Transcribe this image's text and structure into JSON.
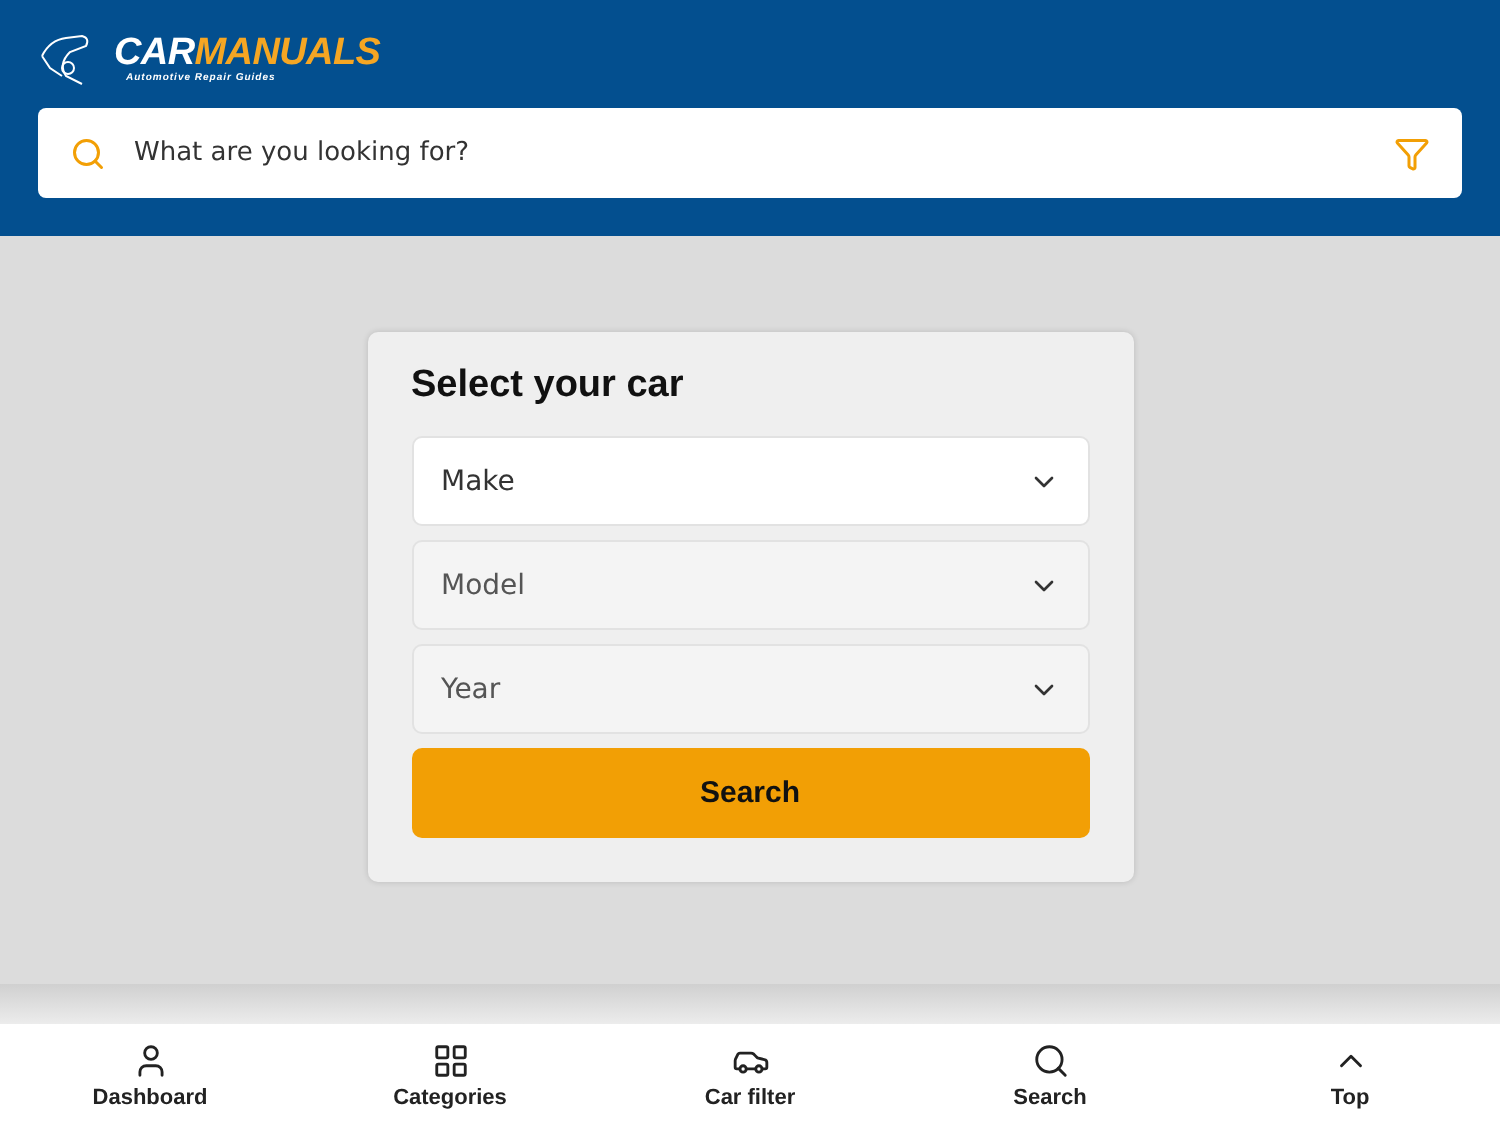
{
  "header": {
    "logo": {
      "first": "CAR",
      "second": "MANUALS",
      "tagline": "Automotive Repair Guides"
    },
    "search": {
      "placeholder": "What are you looking for?"
    }
  },
  "car_selector": {
    "title": "Select your car",
    "selects": [
      {
        "label": "Make",
        "disabled": false
      },
      {
        "label": "Model",
        "disabled": true
      },
      {
        "label": "Year",
        "disabled": true
      }
    ],
    "button": "Search"
  },
  "bottom_nav": [
    {
      "kind": "user",
      "label": "Dashboard"
    },
    {
      "kind": "grid",
      "label": "Categories"
    },
    {
      "kind": "car",
      "label": "Car filter"
    },
    {
      "kind": "search",
      "label": "Search"
    },
    {
      "kind": "up",
      "label": "Top"
    }
  ]
}
